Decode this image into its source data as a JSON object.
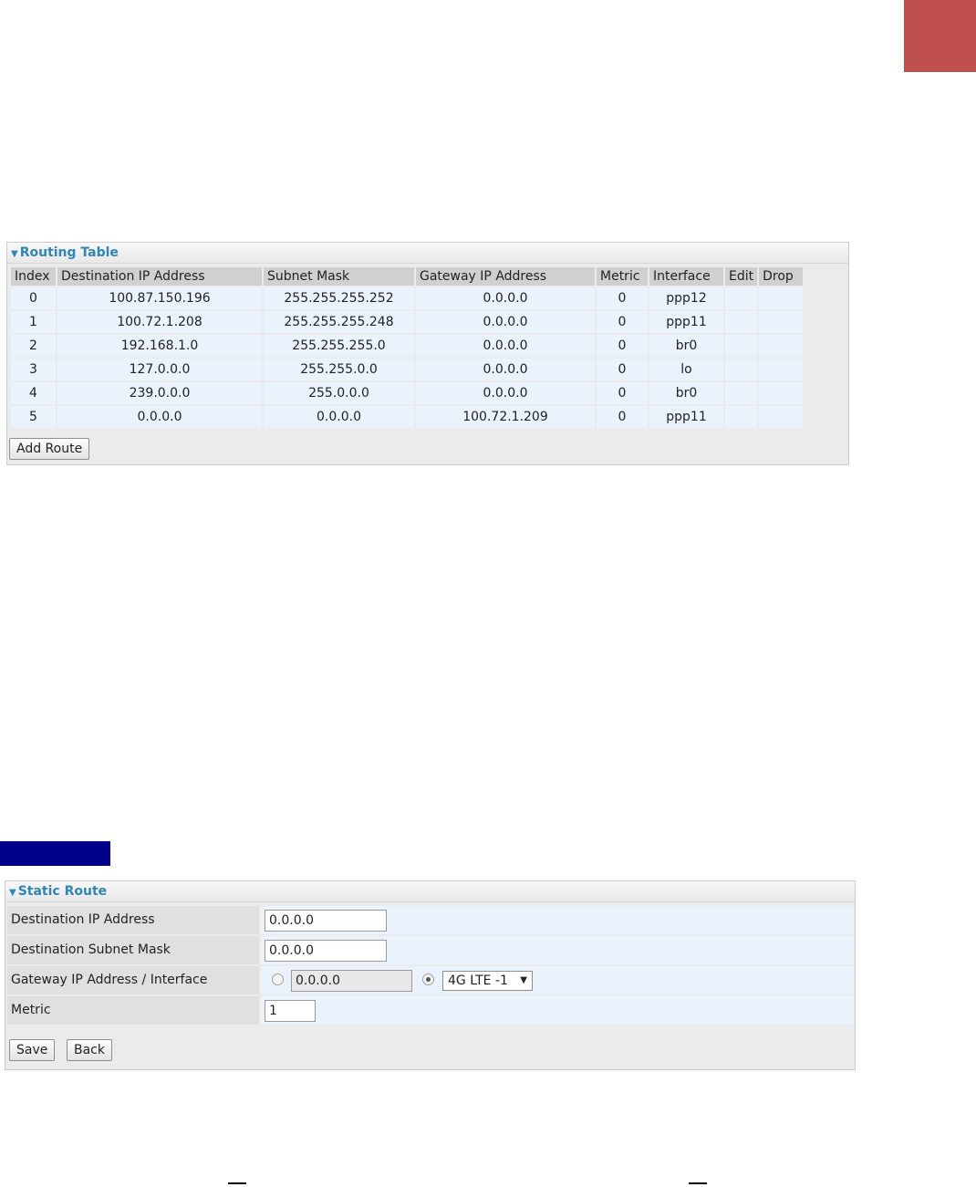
{
  "routing_table": {
    "title": "Routing Table",
    "columns": [
      "Index",
      "Destination IP Address",
      "Subnet Mask",
      "Gateway IP Address",
      "Metric",
      "Interface",
      "Edit",
      "Drop"
    ],
    "rows": [
      [
        "0",
        "100.87.150.196",
        "255.255.255.252",
        "0.0.0.0",
        "0",
        "ppp12",
        "",
        ""
      ],
      [
        "1",
        "100.72.1.208",
        "255.255.255.248",
        "0.0.0.0",
        "0",
        "ppp11",
        "",
        ""
      ],
      [
        "2",
        "192.168.1.0",
        "255.255.255.0",
        "0.0.0.0",
        "0",
        "br0",
        "",
        ""
      ],
      [
        "3",
        "127.0.0.0",
        "255.255.0.0",
        "0.0.0.0",
        "0",
        "lo",
        "",
        ""
      ],
      [
        "4",
        "239.0.0.0",
        "255.0.0.0",
        "0.0.0.0",
        "0",
        "br0",
        "",
        ""
      ],
      [
        "5",
        "0.0.0.0",
        "0.0.0.0",
        "100.72.1.209",
        "0",
        "ppp11",
        "",
        ""
      ]
    ],
    "add_route_label": "Add Route"
  },
  "static_route": {
    "title": "Static Route",
    "dest_ip_label": "Destination IP Address",
    "dest_ip_value": "0.0.0.0",
    "dest_mask_label": "Destination Subnet Mask",
    "dest_mask_value": "0.0.0.0",
    "gateway_label": "Gateway IP Address / Interface",
    "gateway_ip_value": "0.0.0.0",
    "gateway_ip_selected": false,
    "interface_selected": true,
    "interface_value": "4G LTE -1",
    "metric_label": "Metric",
    "metric_value": "1",
    "save_label": "Save",
    "back_label": "Back"
  },
  "colors": {
    "corner_block": "#c0504d",
    "nav_strip": "#00008b",
    "panel_title": "#2f86b8"
  }
}
